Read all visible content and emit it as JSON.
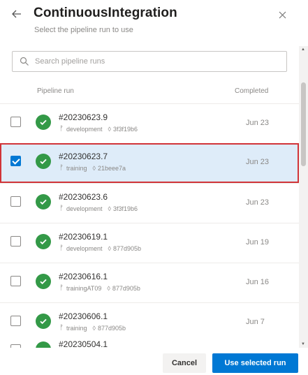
{
  "header": {
    "back_icon": "arrow-left-icon",
    "title": "ContinuousIntegration",
    "subtitle": "Select the pipeline run to use",
    "close_icon": "close-icon"
  },
  "search": {
    "placeholder": "Search pipeline runs",
    "icon": "search-icon"
  },
  "columns": {
    "run": "Pipeline run",
    "completed": "Completed"
  },
  "runs": [
    {
      "number": "#20230623.9",
      "branch": "development",
      "commit": "3f3f19b6",
      "date": "Jun 23",
      "checked": false,
      "status": "succeeded"
    },
    {
      "number": "#20230623.7",
      "branch": "training",
      "commit": "21beee7a",
      "date": "Jun 23",
      "checked": true,
      "status": "succeeded"
    },
    {
      "number": "#20230623.6",
      "branch": "development",
      "commit": "3f3f19b6",
      "date": "Jun 23",
      "checked": false,
      "status": "succeeded"
    },
    {
      "number": "#20230619.1",
      "branch": "development",
      "commit": "877d905b",
      "date": "Jun 19",
      "checked": false,
      "status": "succeeded"
    },
    {
      "number": "#20230616.1",
      "branch": "trainingAT09",
      "commit": "877d905b",
      "date": "Jun 16",
      "checked": false,
      "status": "succeeded"
    },
    {
      "number": "#20230606.1",
      "branch": "training",
      "commit": "877d905b",
      "date": "Jun 7",
      "checked": false,
      "status": "succeeded"
    }
  ],
  "partial_run": {
    "number": "#20230504.1"
  },
  "footer": {
    "cancel_label": "Cancel",
    "use_label": "Use selected run"
  },
  "colors": {
    "accent": "#0078d4",
    "success": "#339947",
    "selection_outline": "#d13438",
    "selection_fill": "#deecf9"
  }
}
